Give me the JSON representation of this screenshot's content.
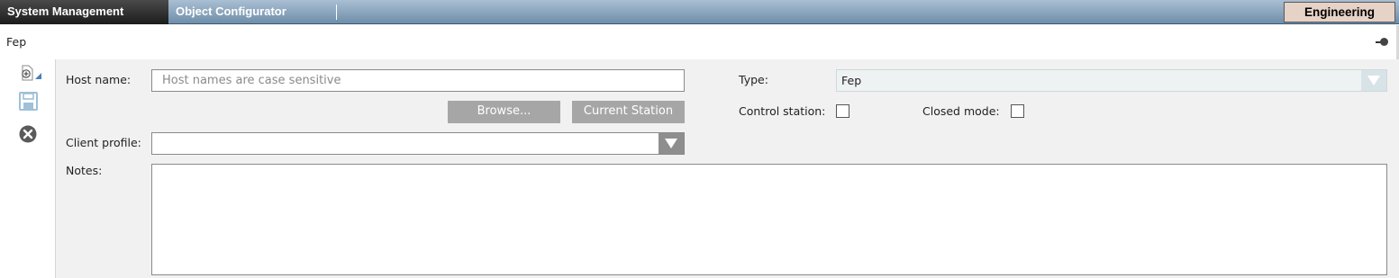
{
  "tabs": {
    "system_management": "System Management",
    "object_configurator": "Object Configurator"
  },
  "workspace_button": "Engineering",
  "panel_title": "Fep",
  "toolbar": {
    "new_icon": "new-document-icon",
    "save_icon": "save-icon",
    "cancel_icon": "cancel-icon"
  },
  "form": {
    "host_name_label": "Host name:",
    "host_name_placeholder": "Host names are case sensitive",
    "host_name_value": "",
    "browse_label": "Browse...",
    "current_station_label": "Current Station",
    "client_profile_label": "Client profile:",
    "client_profile_value": "",
    "notes_label": "Notes:",
    "notes_value": "",
    "type_label": "Type:",
    "type_value": "Fep",
    "control_station_label": "Control station:",
    "control_station_checked": false,
    "closed_mode_label": "Closed mode:",
    "closed_mode_checked": false
  },
  "colors": {
    "tab_bar": "#6f8ea9",
    "active_tab": "#1c1c1c",
    "workspace_button": "#e7d2c7",
    "disabled_button": "#a6a6a6",
    "panel_background": "#f1f1f1"
  }
}
